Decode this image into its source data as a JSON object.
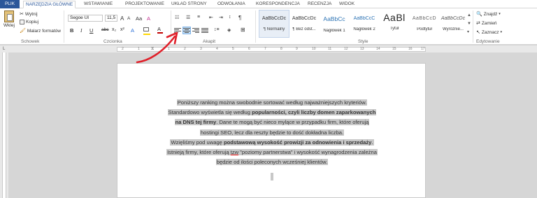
{
  "tabs": {
    "file": "PLIK",
    "items": [
      "NARZĘDZIA GŁÓWNE",
      "WSTAWIANIE",
      "PROJEKTOWANIE",
      "UKŁAD STRONY",
      "ODWOŁANIA",
      "KORESPONDENCJA",
      "RECENZJA",
      "WIDOK"
    ]
  },
  "clipboard": {
    "paste": "Wklej",
    "cut": "Wytnij",
    "copy": "Kopiuj",
    "format_painter": "Malarz formatów",
    "label": "Schowek"
  },
  "font": {
    "name": "Segoe UI",
    "size": "11,5",
    "label": "Czcionka",
    "bold": "B",
    "italic": "I",
    "underline": "U",
    "strike": "abc",
    "sub": "x₂",
    "sup": "x²",
    "grow": "A",
    "shrink": "A",
    "case": "Aa",
    "clear": "A",
    "color_a": "A",
    "highlight_color": "#ffd800",
    "font_color": "#c00000"
  },
  "paragraph": {
    "label": "Akapit",
    "pilcrow": "¶"
  },
  "styles": {
    "label": "Style",
    "items": [
      {
        "sample": "AaBbCcDc",
        "name": "¶ Normalny"
      },
      {
        "sample": "AaBbCcDc",
        "name": "¶ Bez odst..."
      },
      {
        "sample": "AaBbCc",
        "name": "Nagłówek 1"
      },
      {
        "sample": "AaBbCcC",
        "name": "Nagłówek 2"
      },
      {
        "sample": "AaBl",
        "name": "Tytuł"
      },
      {
        "sample": "AaBbCcD",
        "name": "Podtytuł"
      },
      {
        "sample": "AaBbCcDc",
        "name": "Wyróżnie..."
      }
    ]
  },
  "editing": {
    "find": "Znajdź",
    "replace": "Zamień",
    "select": "Zaznacz",
    "label": "Edytowanie"
  },
  "ruler": {
    "numbers": [
      "2",
      "1",
      "1",
      "2",
      "3",
      "4",
      "5",
      "6",
      "7",
      "8",
      "9",
      "10",
      "11",
      "12",
      "13",
      "14",
      "15",
      "16",
      "17"
    ]
  },
  "document": {
    "line1": "Poniższy ranking można swobodnie sortować według najważniejszych kryteriów.",
    "line2_a": "Standardowo wyświetla się według ",
    "line2_b": "popularności, czyli liczby domen zaparkowanych",
    "line3_a": "na DNS tej firmy",
    "line3_b": ". Dane te mogą być nieco mylące w przypadku firm, które oferują",
    "line4": "hostingi SEO, lecz dla reszty będzie to dość dokładna liczba.",
    "line5_a": "Wzięliśmy pod uwagę ",
    "line5_b": "podstawową wysokość prowizji za odnowienia i sprzedaży",
    "line5_c": ".",
    "line6_a": "Istnieją firmy, które oferują ",
    "line6_b": "tzw",
    "line6_c": " \"poziomy partnerstwa\" i wysokość wynagrodzenia zależna",
    "line7": "będzie od ilości poleconych wcześniej klientów."
  },
  "colors": {
    "file_tab": "#2b579a",
    "selection": "#c8c8c8",
    "arrow": "#e0202a"
  }
}
